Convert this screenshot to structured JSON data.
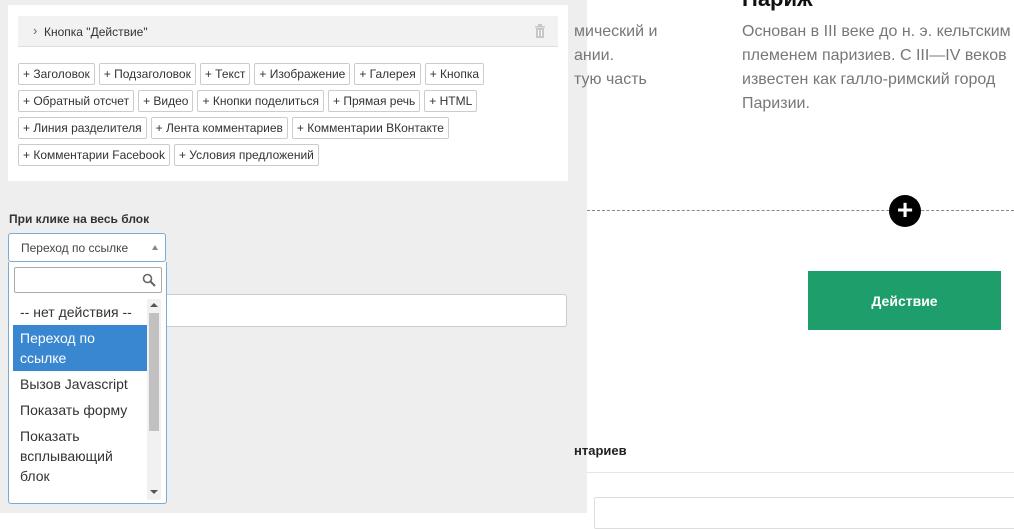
{
  "editor": {
    "accordion_label": "Кнопка \"Действие\"",
    "chip_rows": [
      [
        "+ Заголовок",
        "+ Подзаголовок",
        "+ Текст",
        "+ Изображение",
        "+ Галерея",
        "+ Кнопка"
      ],
      [
        "+ Обратный отсчет",
        "+ Видео",
        "+ Кнопки поделиться",
        "+ Прямая речь",
        "+ HTML"
      ],
      [
        "+ Линия разделителя",
        "+ Лента комментариев",
        "+ Комментарии ВКонтакте"
      ],
      [
        "+ Комментарии Facebook",
        "+ Условия предложений"
      ]
    ],
    "click_label": "При клике на весь блок",
    "select_value": "Переход по ссылке",
    "dropdown_search_value": "",
    "options": [
      {
        "label": "-- нет действия --",
        "selected": false
      },
      {
        "label": "Переход по ссылке",
        "selected": true
      },
      {
        "label": "Вызов Javascript",
        "selected": false
      },
      {
        "label": "Показать форму",
        "selected": false
      },
      {
        "label": "Показать всплывающий блок",
        "selected": false
      }
    ]
  },
  "preview": {
    "heading": "Париж",
    "left_text": "мический и\nании.\nтую часть",
    "right_text": "Основан в III веке до н. э. кельтским племенем паризиев. С III—IV веков известен как галло-римский город Паризии.",
    "action_button": "Действие",
    "comments_title": "нтариев"
  },
  "colors": {
    "accent_green": "#1e9e6b",
    "selected_blue": "#3a87d1",
    "panel_bg": "#eeeeee"
  }
}
